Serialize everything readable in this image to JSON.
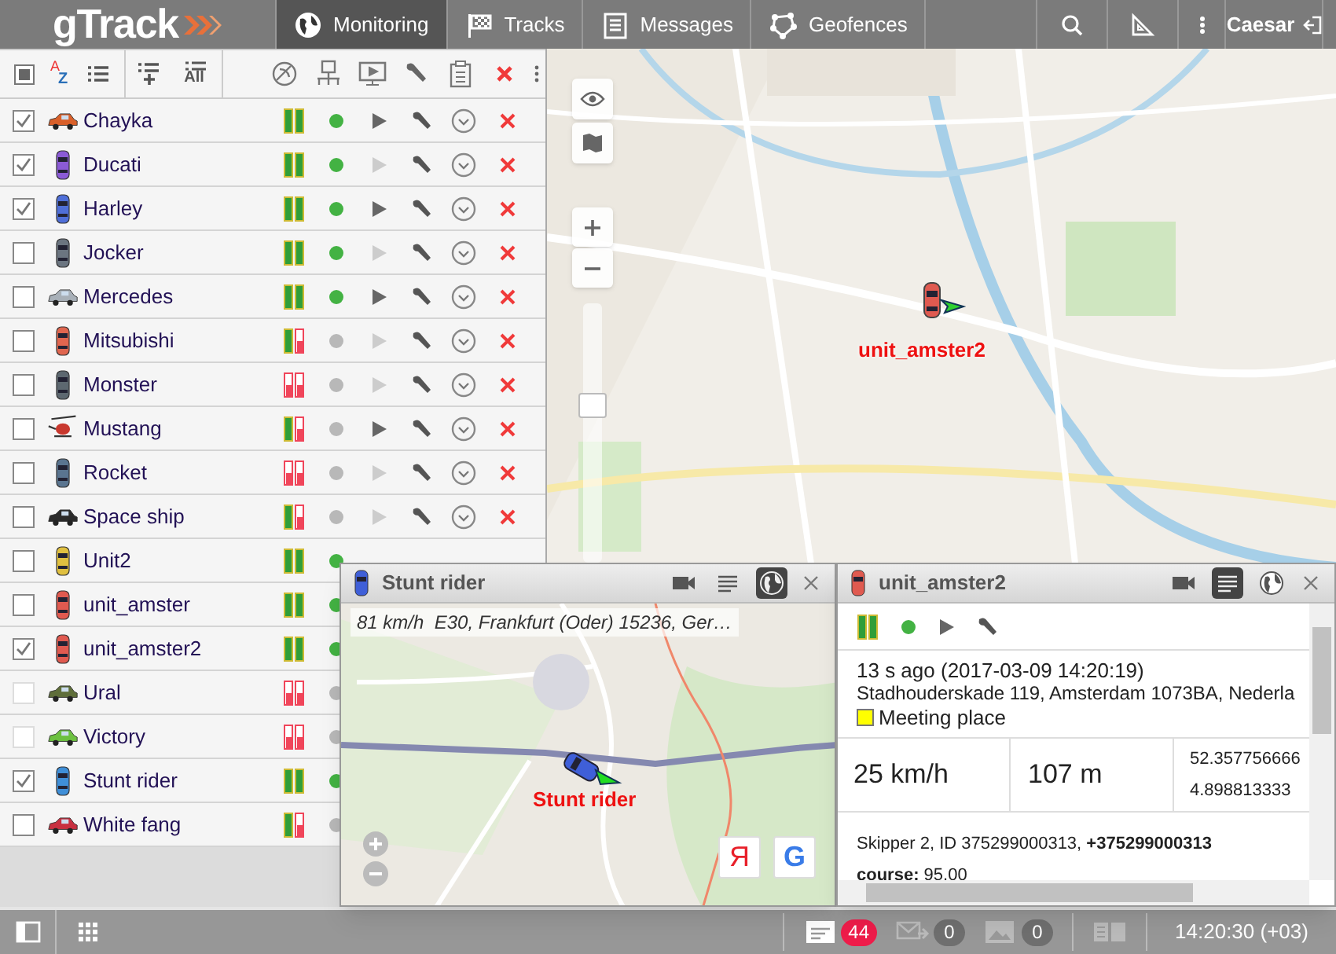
{
  "app": {
    "logo": "gTrack"
  },
  "nav": [
    {
      "label": "Monitoring",
      "selected": true
    },
    {
      "label": "Tracks",
      "selected": false
    },
    {
      "label": "Messages",
      "selected": false
    },
    {
      "label": "Geofences",
      "selected": false
    }
  ],
  "user": {
    "name": "Caesar"
  },
  "list_toolbar": {
    "select_all": {
      "indeterminate": true
    },
    "all_label": "All",
    "sort_label_top": "A",
    "sort_label_bottom": "Z"
  },
  "units": [
    {
      "name": "Chayka",
      "checked": true,
      "disabled": false,
      "kind": "side",
      "color": "#d9602a",
      "bar_1": true,
      "bar_2": true,
      "online": true,
      "track_active": true
    },
    {
      "name": "Ducati",
      "checked": true,
      "disabled": false,
      "kind": "top",
      "color": "#8b5bd6",
      "bar_1": true,
      "bar_2": true,
      "online": true,
      "track_active": false
    },
    {
      "name": "Harley",
      "checked": true,
      "disabled": false,
      "kind": "top",
      "color": "#4f6fd8",
      "bar_1": true,
      "bar_2": true,
      "online": true,
      "track_active": true
    },
    {
      "name": "Jocker",
      "checked": false,
      "disabled": false,
      "kind": "top",
      "color": "#6b7580",
      "bar_1": true,
      "bar_2": true,
      "online": true,
      "track_active": false
    },
    {
      "name": "Mercedes",
      "checked": false,
      "disabled": false,
      "kind": "side",
      "color": "#a8b0b8",
      "bar_1": true,
      "bar_2": true,
      "online": true,
      "track_active": true
    },
    {
      "name": "Mitsubishi",
      "checked": false,
      "disabled": false,
      "kind": "top",
      "color": "#e0664f",
      "bar_1": true,
      "bar_2": false,
      "online": false,
      "track_active": false
    },
    {
      "name": "Monster",
      "checked": false,
      "disabled": false,
      "kind": "top",
      "color": "#5d6870",
      "bar_1": false,
      "bar_2": false,
      "online": false,
      "track_active": false
    },
    {
      "name": "Mustang",
      "checked": false,
      "disabled": false,
      "kind": "helicopter",
      "color": "#c8382e",
      "bar_1": true,
      "bar_2": false,
      "online": false,
      "track_active": true
    },
    {
      "name": "Rocket",
      "checked": false,
      "disabled": false,
      "kind": "top",
      "color": "#5a7590",
      "bar_1": false,
      "bar_2": false,
      "online": false,
      "track_active": false
    },
    {
      "name": "Space ship",
      "checked": false,
      "disabled": false,
      "kind": "side",
      "color": "#2a2a2a",
      "bar_1": true,
      "bar_2": false,
      "online": false,
      "track_active": false
    },
    {
      "name": "Unit2",
      "checked": false,
      "disabled": false,
      "kind": "top",
      "color": "#e0c040",
      "bar_1": true,
      "bar_2": true,
      "online": true
    },
    {
      "name": "unit_amster",
      "checked": false,
      "disabled": false,
      "kind": "top",
      "color": "#e05a50",
      "bar_1": true,
      "bar_2": true,
      "online": true
    },
    {
      "name": "unit_amster2",
      "checked": true,
      "disabled": false,
      "kind": "top",
      "color": "#e05a50",
      "bar_1": true,
      "bar_2": true,
      "online": true
    },
    {
      "name": "Ural",
      "checked": false,
      "disabled": true,
      "kind": "side",
      "color": "#5f6e3a",
      "bar_1": false,
      "bar_2": false,
      "online": false
    },
    {
      "name": "Victory",
      "checked": false,
      "disabled": true,
      "kind": "side",
      "color": "#6cc040",
      "bar_1": false,
      "bar_2": false,
      "online": false
    },
    {
      "name": "Stunt rider",
      "checked": true,
      "disabled": false,
      "kind": "top",
      "color": "#3f8fd8",
      "bar_1": true,
      "bar_2": true,
      "online": true
    },
    {
      "name": "White fang",
      "checked": false,
      "disabled": false,
      "kind": "side",
      "color": "#c83040",
      "bar_1": true,
      "bar_2": false,
      "online": false
    }
  ],
  "map": {
    "marker_label": "unit_amster2",
    "zoom": {
      "level": 0.62
    }
  },
  "popups": [
    {
      "title": "Stunt rider",
      "color": "#3f5fd8",
      "tabs": [
        {
          "selected": false
        },
        {
          "selected": false
        },
        {
          "selected": true
        }
      ],
      "info": "81 km/h  E30, Frankfurt (Oder) 15236, Ger…",
      "marker_label": "Stunt rider",
      "providers": [
        "Я",
        "G"
      ]
    },
    {
      "title": "unit_amster2",
      "color": "#e05a50",
      "tabs": [
        {
          "selected": false
        },
        {
          "selected": true
        },
        {
          "selected": false
        }
      ],
      "status": {
        "bar_1": true,
        "bar_2": true,
        "online": true,
        "track_active": true
      },
      "time": "13 s ago (2017-03-09 14:20:19)",
      "address": "Stadhouderskade 119, Amsterdam 1073BA, Nederla",
      "geofence": {
        "name": "Meeting place",
        "color": "#ffff00"
      },
      "speed": "25 km/h",
      "altitude": "107 m",
      "lat": "52.357756666",
      "lon": "4.898813333",
      "device": "Skipper 2, ID 375299000313, **+375299000313**",
      "param": "**course:** 95.00"
    }
  ],
  "status_bar": {
    "messages": "44",
    "sent": "0",
    "media": "0",
    "time": "14:20:30 (+03)"
  }
}
